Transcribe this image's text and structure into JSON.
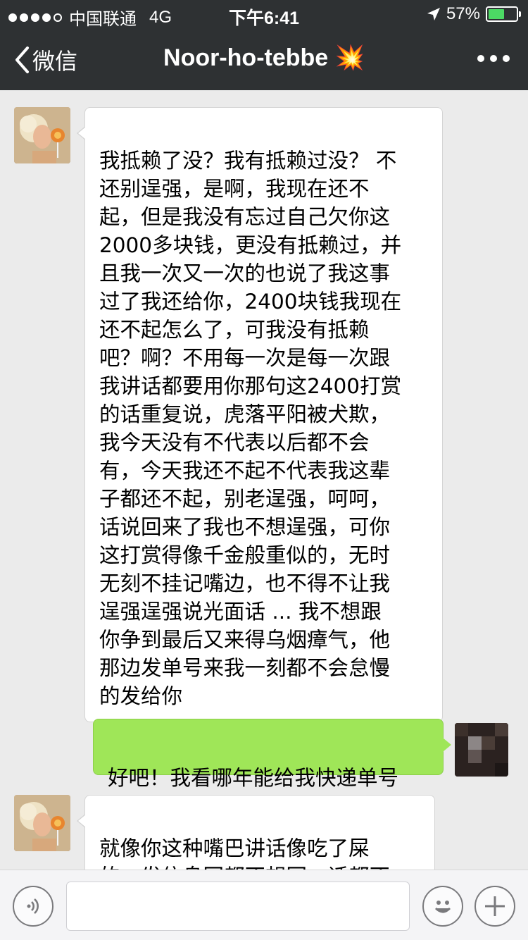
{
  "status_bar": {
    "carrier": "中国联通",
    "network": "4G",
    "time": "下午6:41",
    "battery_percent": "57%",
    "battery_level": 0.57,
    "signal_strength": 4
  },
  "nav": {
    "back_label": "微信",
    "chat_title": "Noor-ho-tebbe 💥",
    "more_icon": "more-dots-icon"
  },
  "messages": [
    {
      "direction": "incoming",
      "text": "我抵赖了没？我有抵赖过没？ 不\n还别逞强，是啊，我现在还不\n起，但是我没有忘过自己欠你这\n2000多块钱，更没有抵赖过，并\n且我一次又一次的也说了我这事\n过了我还给你，2400块钱我现在\n还不起怎么了，可我没有抵赖\n吧？啊？不用每一次是每一次跟\n我讲话都要用你那句这2400打赏\n的话重复说，虎落平阳被犬欺，\n我今天没有不代表以后都不会\n有，今天我还不起不代表我这辈\n子都还不起，别老逞强，呵呵，\n话说回来了我也不想逞强，可你\n这打赏得像千金般重似的，无时\n无刻不挂记嘴边，也不得不让我\n逞强逞强说光面话 ...  我不想跟\n你争到最后又来得乌烟瘴气，他\n那边发单号来我一刻都不会怠慢\n的发给你"
    },
    {
      "direction": "outgoing",
      "text": "好吧！我看哪年能给我快递单号"
    },
    {
      "direction": "incoming",
      "text": "就像你这种嘴巴讲话像吃了屎\n的，发信息回都不想回，话都不"
    }
  ],
  "input_bar": {
    "voice_icon": "voice-icon",
    "emoji_icon": "emoji-icon",
    "add_icon": "plus-icon",
    "input_value": ""
  },
  "colors": {
    "nav_bg": "#2e3133",
    "chat_bg": "#ebebeb",
    "bubble_out": "#9fe658",
    "bubble_in": "#ffffff",
    "battery_fill": "#4cd964"
  }
}
